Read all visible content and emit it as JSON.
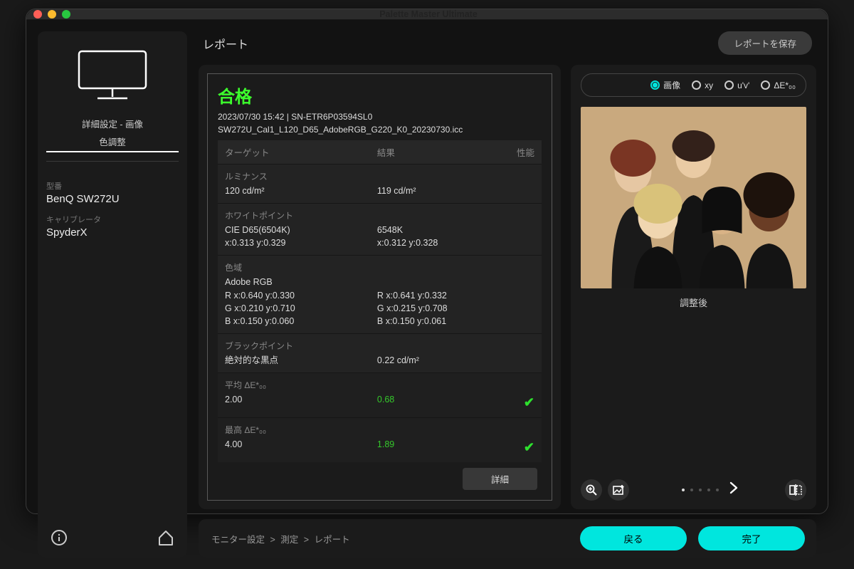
{
  "window": {
    "title": "Palette Master Ultimate"
  },
  "header": {
    "title": "レポート",
    "save_btn": "レポートを保存"
  },
  "sidebar": {
    "context": "詳細設定 - 画像",
    "mode": "色調整",
    "model_label": "型番",
    "model": "BenQ SW272U",
    "cal_label": "キャリブレータ",
    "calibrator": "SpyderX"
  },
  "report": {
    "status": "合格",
    "meta": "2023/07/30 15:42 | SN-ETR6P03594SL0",
    "icc": "SW272U_Cal1_L120_D65_AdobeRGB_G220_K0_20230730.icc",
    "cols": {
      "target": "ターゲット",
      "result": "結果",
      "perf": "性能"
    },
    "lum": {
      "label": "ルミナンス",
      "target": "120 cd/m²",
      "result": "119 cd/m²"
    },
    "wp": {
      "label": "ホワイトポイント",
      "target1": "CIE D65(6504K)",
      "result1": "6548K",
      "target2": "x:0.313 y:0.329",
      "result2": "x:0.312 y:0.328"
    },
    "gamut": {
      "label": "色域",
      "space": "Adobe RGB",
      "r_t": "R x:0.640 y:0.330",
      "r_r": "R x:0.641 y:0.332",
      "g_t": "G x:0.210 y:0.710",
      "g_r": "G x:0.215 y:0.708",
      "b_t": "B x:0.150 y:0.060",
      "b_r": "B x:0.150 y:0.061"
    },
    "bp": {
      "label": "ブラックポイント",
      "target": "絶対的な黒点",
      "result": "0.22 cd/m²"
    },
    "avg": {
      "label": "平均 ΔE*₀₀",
      "target": "2.00",
      "result": "0.68"
    },
    "max": {
      "label": "最高 ΔE*₀₀",
      "target": "4.00",
      "result": "1.89"
    },
    "detail_btn": "詳細"
  },
  "preview": {
    "modes": {
      "image": "画像",
      "xy": "xy",
      "uv": "u'v'",
      "de": "ΔE*₀₀"
    },
    "caption": "調整後"
  },
  "footer": {
    "crumbs": {
      "a": "モニター設定",
      "b": "測定",
      "c": "レポート",
      "sep": ">"
    },
    "back": "戻る",
    "done": "完了"
  }
}
